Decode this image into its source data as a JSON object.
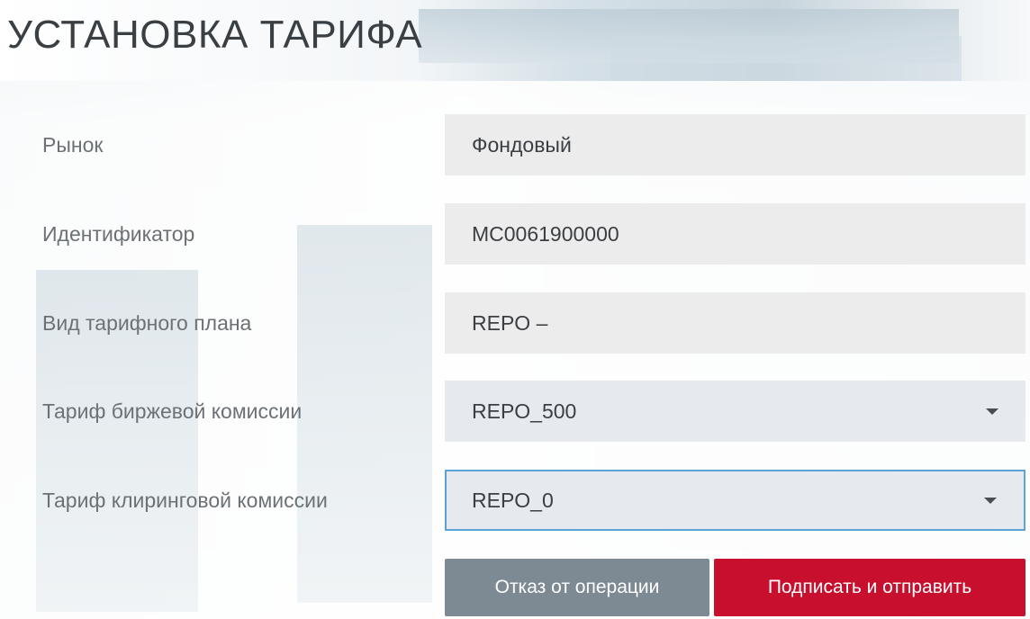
{
  "page": {
    "title": "УСТАНОВКА ТАРИФА"
  },
  "form": {
    "fields": [
      {
        "label": "Рынок",
        "value": "Фондовый",
        "type": "readonly"
      },
      {
        "label": "Идентификатор",
        "value": "MC0061900000",
        "type": "readonly"
      },
      {
        "label": "Вид тарифного плана",
        "value": "REPO –",
        "type": "readonly"
      },
      {
        "label": "Тариф биржевой комиссии",
        "value": "REPO_500",
        "type": "select",
        "icon": "caret-down-icon"
      },
      {
        "label": "Тариф клиринговой комиссии",
        "value": "REPO_0",
        "type": "select",
        "focused": true,
        "icon": "caret-down-icon"
      }
    ]
  },
  "actions": {
    "cancel_label": "Отказ от операции",
    "submit_label": "Подписать и отправить"
  },
  "colors": {
    "submit": "#c8102e",
    "cancel": "#7d8a93",
    "focus_border": "#5aa3d4",
    "field_bg": "#ececec"
  }
}
